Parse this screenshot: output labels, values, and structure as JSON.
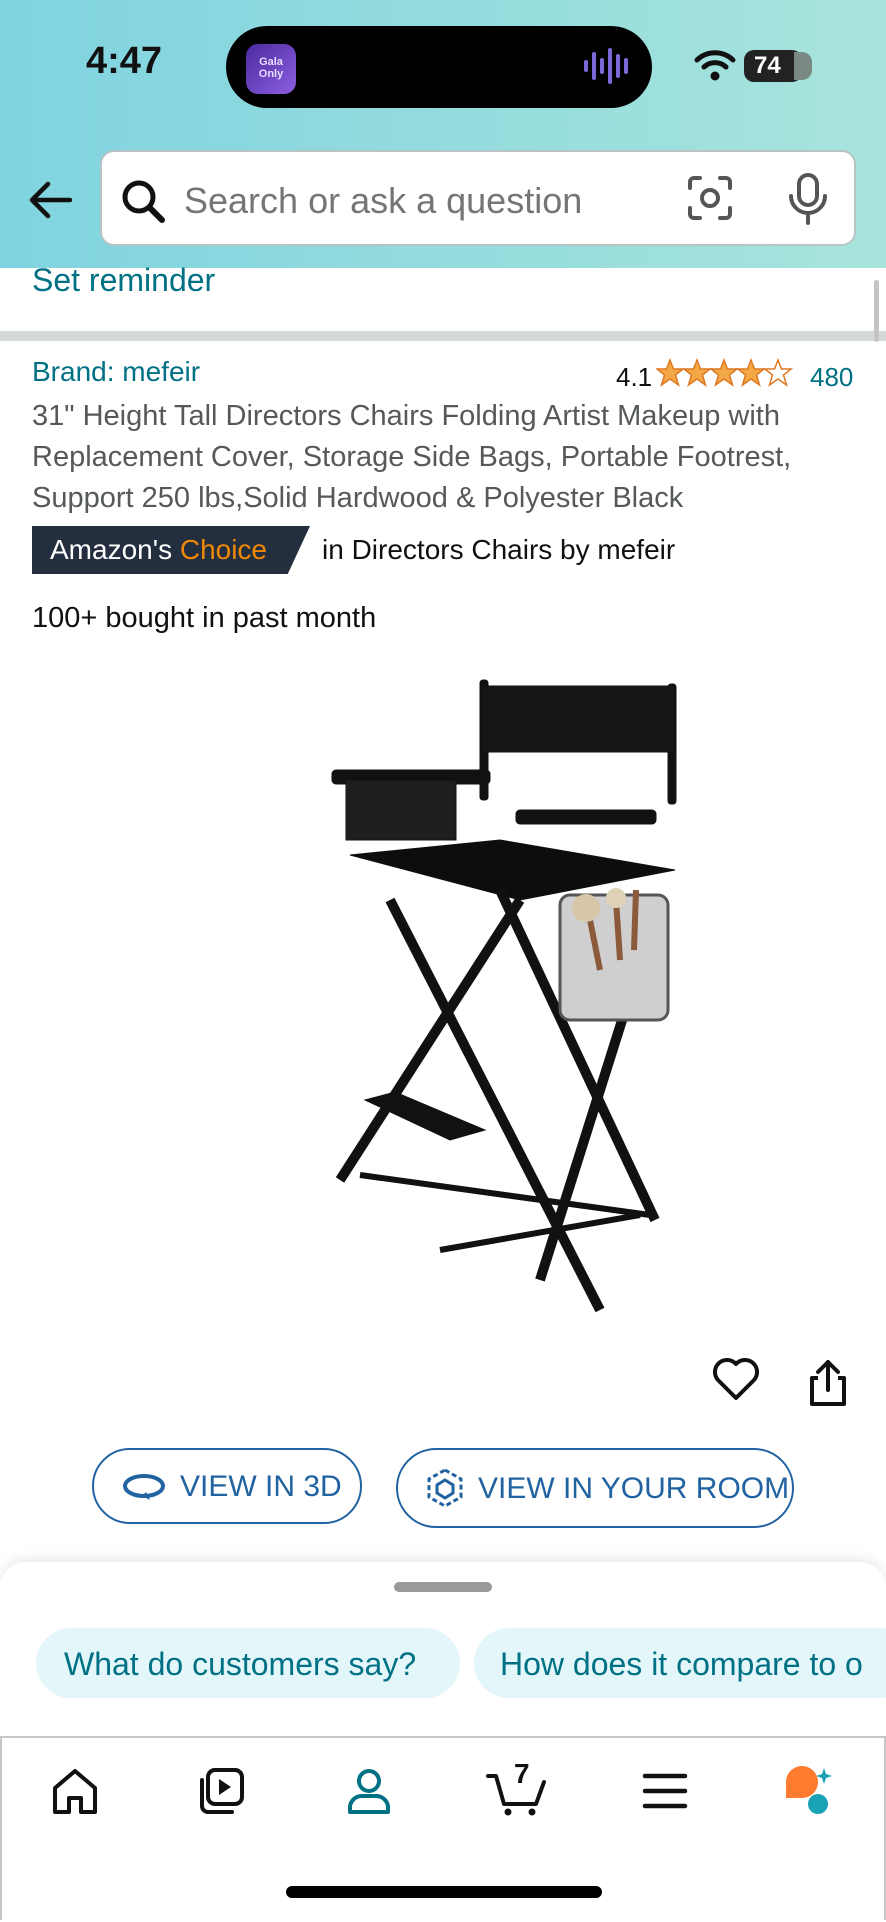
{
  "status_bar": {
    "time": "4:47",
    "battery": "74",
    "island_app_label": "Gala Only"
  },
  "search": {
    "placeholder": "Search or ask a question"
  },
  "reminder_link": "Set reminder",
  "product": {
    "brand": "Brand: mefeir",
    "rating": "4.1",
    "rating_stars": 4.1,
    "rating_count": "480",
    "title": "31\" Height Tall Directors Chairs Folding Artist Makeup with Replacement Cover, Storage Side Bags, Portable Footrest, Support 250 lbs,Solid Hardwood & Polyester Black",
    "badge_prefix": "Amazon's ",
    "badge_highlight": "Choice",
    "badge_category": "in Directors Chairs by mefeir",
    "bought": "100+ bought in past month"
  },
  "actions": {
    "view_3d": "VIEW IN 3D",
    "view_room": "VIEW IN YOUR ROOM"
  },
  "chips": [
    {
      "label": "What do customers say?"
    },
    {
      "label": "How does it compare to o"
    }
  ],
  "nav": {
    "cart_count": "7"
  },
  "colors": {
    "link": "#007185",
    "accent_orange": "#f08804",
    "badge_dark": "#232f3e",
    "button_blue": "#2162a1",
    "star": "#f3a847"
  }
}
